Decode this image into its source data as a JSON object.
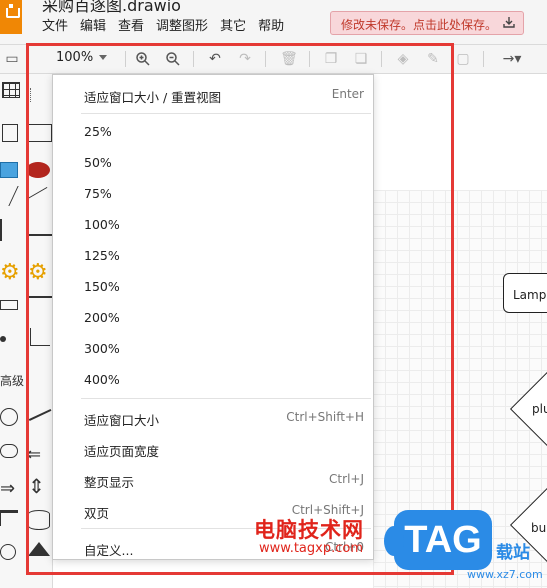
{
  "app": {
    "document_title": "采购百逐图.drawio",
    "menu": [
      "文件",
      "编辑",
      "查看",
      "调整图形",
      "其它",
      "帮助"
    ],
    "unsaved_notice": "修改未保存。点击此处保存。"
  },
  "toolbar": {
    "zoom_value": "100%"
  },
  "left_panel": {
    "section_label": "高级"
  },
  "dropdown": {
    "items": [
      {
        "label": "适应窗口大小 / 重置视图",
        "shortcut": "Enter"
      },
      {
        "label": "25%",
        "shortcut": ""
      },
      {
        "label": "50%",
        "shortcut": ""
      },
      {
        "label": "75%",
        "shortcut": ""
      },
      {
        "label": "100%",
        "shortcut": ""
      },
      {
        "label": "125%",
        "shortcut": ""
      },
      {
        "label": "150%",
        "shortcut": ""
      },
      {
        "label": "200%",
        "shortcut": ""
      },
      {
        "label": "300%",
        "shortcut": ""
      },
      {
        "label": "400%",
        "shortcut": ""
      },
      {
        "label": "适应窗口大小",
        "shortcut": "Ctrl+Shift+H"
      },
      {
        "label": "适应页面宽度",
        "shortcut": ""
      },
      {
        "label": "整页显示",
        "shortcut": "Ctrl+J"
      },
      {
        "label": "双页",
        "shortcut": "Ctrl+Shift+J"
      },
      {
        "label": "自定义...",
        "shortcut": "Ctrl+0"
      }
    ]
  },
  "canvas": {
    "shapes": [
      "Lamp",
      "plu",
      "bur"
    ]
  },
  "watermark": {
    "site_name": "电脑技术网",
    "site_url": "www.tagxp.com",
    "badge": "TAG",
    "badge_suffix": "载站",
    "url2": "www.xz7.com"
  },
  "colors": {
    "highlight": "#e53935",
    "brand": "#f08705",
    "unsaved_bg": "#f8d7da"
  }
}
